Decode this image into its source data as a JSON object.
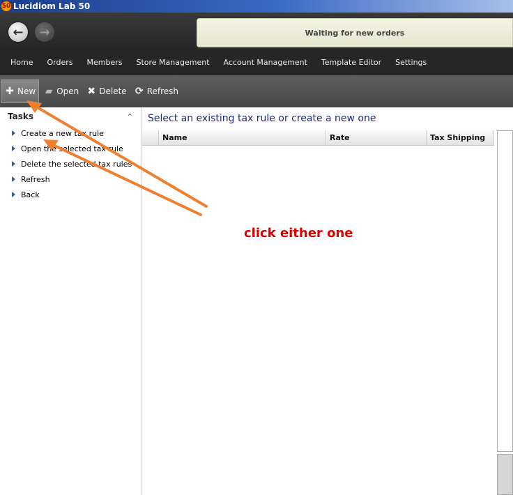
{
  "window": {
    "badge": "50",
    "title": "Lucidiom Lab 50"
  },
  "status": {
    "text": "Waiting for new orders"
  },
  "menu": [
    "Home",
    "Orders",
    "Members",
    "Store Management",
    "Account Management",
    "Template Editor",
    "Settings"
  ],
  "toolbar": {
    "new": "New",
    "open": "Open",
    "delete": "Delete",
    "refresh": "Refresh"
  },
  "tasks": {
    "title": "Tasks",
    "items": [
      "Create a new tax rule",
      "Open the selected tax rule",
      "Delete the selected tax rules",
      "Refresh",
      "Back"
    ]
  },
  "main": {
    "title": "Select an existing tax rule or create a new one",
    "columns": [
      "Name",
      "Rate",
      "Tax Shipping"
    ]
  },
  "annotation": {
    "text": "click either one",
    "arrow_color": "#f08030",
    "text_color": "#d80000"
  },
  "icons": {
    "back": "arrow-left-icon",
    "forward": "arrow-right-icon",
    "new": "plus-icon",
    "open": "folder-icon",
    "delete": "x-icon",
    "refresh": "refresh-icon",
    "collapse": "chevron-up-icon"
  }
}
